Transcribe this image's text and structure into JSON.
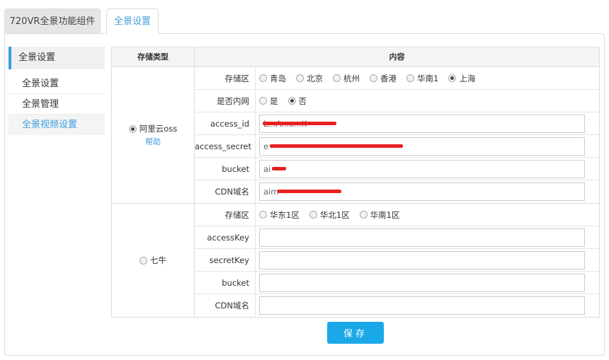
{
  "tabs": [
    "720VR全景功能组件",
    "全景设置"
  ],
  "sidebar": {
    "header": "全景设置",
    "items": [
      "全景设置",
      "全景管理",
      "全景视频设置"
    ]
  },
  "table": {
    "headers": [
      "存储类型",
      "内容"
    ],
    "oss": {
      "type_label": "阿里云oss",
      "help": "帮助",
      "region_label": "存储区",
      "regions": [
        "青岛",
        "北京",
        "杭州",
        "香港",
        "华南1",
        "上海"
      ],
      "intranet_label": "是否内网",
      "intranet_opts": [
        "是",
        "否"
      ],
      "access_id_label": "access_id",
      "access_id_value": "L...A...o...K",
      "access_secret_label": "access_secret",
      "access_secret_value": "e",
      "bucket_label": "bucket",
      "bucket_value": "ai",
      "cdn_label": "CDN域名",
      "cdn_value": "aim"
    },
    "qiniu": {
      "type_label": "七牛",
      "region_label": "存储区",
      "regions": [
        "华东1区",
        "华北1区",
        "华南1区"
      ],
      "access_key_label": "accessKey",
      "access_key_value": "",
      "secret_key_label": "secretKey",
      "secret_key_value": "",
      "bucket_label": "bucket",
      "bucket_value": "",
      "cdn_label": "CDN域名",
      "cdn_value": ""
    }
  },
  "save_label": "保存",
  "colors": {
    "accent": "#3b9de0",
    "button": "#1aa8e8",
    "redaction": "#e82020"
  }
}
